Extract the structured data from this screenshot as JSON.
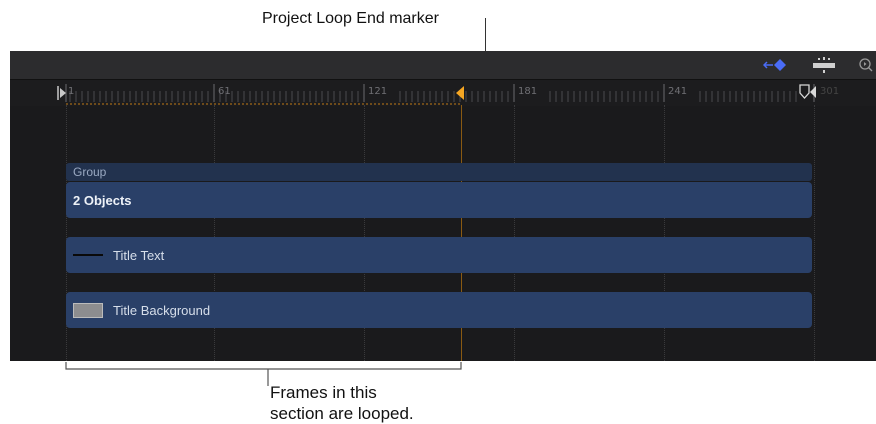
{
  "annotations": {
    "top_callout": "Project Loop End marker",
    "bottom_callout_line1": "Frames in this",
    "bottom_callout_line2": "section are looped."
  },
  "toolbar": {
    "icons": [
      "keyframe-diamond-icon",
      "snapping-icon",
      "zoom-icon"
    ],
    "accent_color": "#4a6cf7"
  },
  "ruler": {
    "labels": [
      "1",
      "61",
      "121",
      "181",
      "241",
      "301"
    ],
    "loop_end_color": "#f5a623"
  },
  "tracks": {
    "group_label": "Group",
    "objects_label": "2 Objects",
    "title_text_label": "Title Text",
    "title_background_label": "Title Background"
  },
  "colors": {
    "panel_bg": "#1a1a1c",
    "bar": "#2a4068",
    "group_header": "#22324e"
  }
}
